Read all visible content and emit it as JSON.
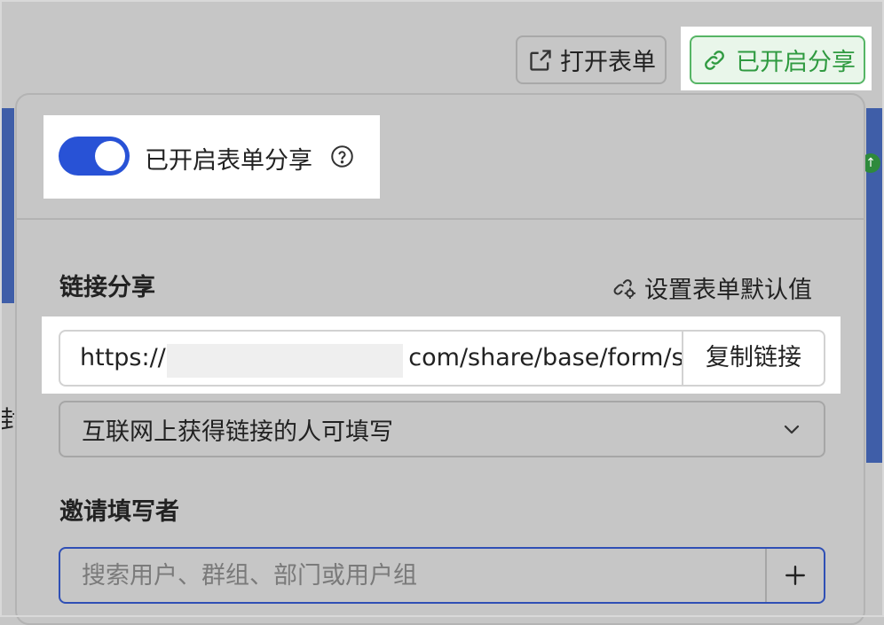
{
  "header": {
    "open_form_label": "打开表单",
    "share_label": "已开启分享"
  },
  "share_toggle": {
    "label": "已开启表单分享",
    "enabled": true
  },
  "link_share": {
    "title": "链接分享",
    "defaults_link_label": "设置表单默认值",
    "url_prefix": "https://l",
    "url_suffix": "com/share/base/form/sl",
    "copy_label": "复制链接",
    "permission_value": "互联网上获得链接的人可填写"
  },
  "invite": {
    "title": "邀请填写者",
    "placeholder": "搜索用户、群组、部门或用户组"
  },
  "colors": {
    "accent": "#2852d6",
    "share_green": "#2f9a40",
    "overlay": "#c6c6c6"
  },
  "icons": [
    "external-link-icon",
    "link-icon",
    "help-icon",
    "settings-link-icon",
    "chevron-down-icon",
    "plus-icon"
  ]
}
